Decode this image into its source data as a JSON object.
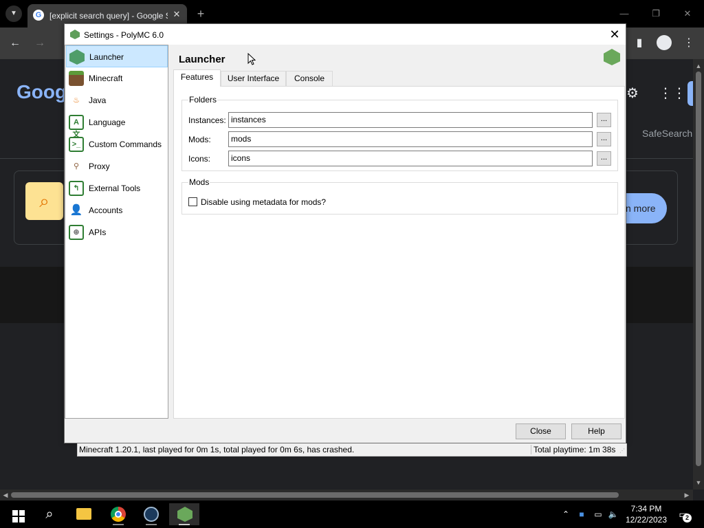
{
  "browser": {
    "tab_title": "[explicit search query] - Google Search",
    "tab_favicon": "G",
    "menu_icon": "chevron-down-icon",
    "new_tab": "+",
    "close_tab": "✕",
    "win_min": "—",
    "win_max": "❐",
    "win_close": "✕",
    "page": {
      "logo_text": "Goog",
      "safesearch": "SafeSearch",
      "learn_more": "n more"
    }
  },
  "dialog": {
    "title": "Settings - PolyMC 6.0",
    "close_glyph": "✕",
    "nav": [
      {
        "label": "Launcher",
        "icon": "launcher-icon",
        "selected": true
      },
      {
        "label": "Minecraft",
        "icon": "minecraft-icon",
        "selected": false
      },
      {
        "label": "Java",
        "icon": "java-icon",
        "selected": false
      },
      {
        "label": "Language",
        "icon": "language-icon",
        "selected": false
      },
      {
        "label": "Custom Commands",
        "icon": "custom-commands-icon",
        "selected": false
      },
      {
        "label": "Proxy",
        "icon": "proxy-icon",
        "selected": false
      },
      {
        "label": "External Tools",
        "icon": "external-tools-icon",
        "selected": false
      },
      {
        "label": "Accounts",
        "icon": "accounts-icon",
        "selected": false
      },
      {
        "label": "APIs",
        "icon": "apis-icon",
        "selected": false
      }
    ],
    "page_title": "Launcher",
    "tabs": [
      {
        "label": "Features",
        "active": true
      },
      {
        "label": "User Interface",
        "active": false
      },
      {
        "label": "Console",
        "active": false
      }
    ],
    "folders": {
      "group_title": "Folders",
      "rows": [
        {
          "label": "Instances:",
          "value": "instances",
          "browse": "..."
        },
        {
          "label": "Mods:",
          "value": "mods",
          "browse": "..."
        },
        {
          "label": "Icons:",
          "value": "icons",
          "browse": "..."
        }
      ]
    },
    "mods": {
      "group_title": "Mods",
      "checkbox_label": "Disable using metadata for mods?",
      "checked": false
    },
    "buttons": {
      "close": "Close",
      "help": "Help"
    },
    "status": {
      "left": "Minecraft 1.20.1, last played for 0m 1s, total played for 0m 6s, has crashed.",
      "right": "Total playtime: 1m 38s"
    }
  },
  "taskbar": {
    "apps": [
      "start-icon",
      "search-icon",
      "file-explorer-icon",
      "chrome-icon",
      "steam-icon",
      "polymc-icon"
    ],
    "time": "7:34 PM",
    "date": "12/22/2023",
    "notification_count": "2"
  }
}
